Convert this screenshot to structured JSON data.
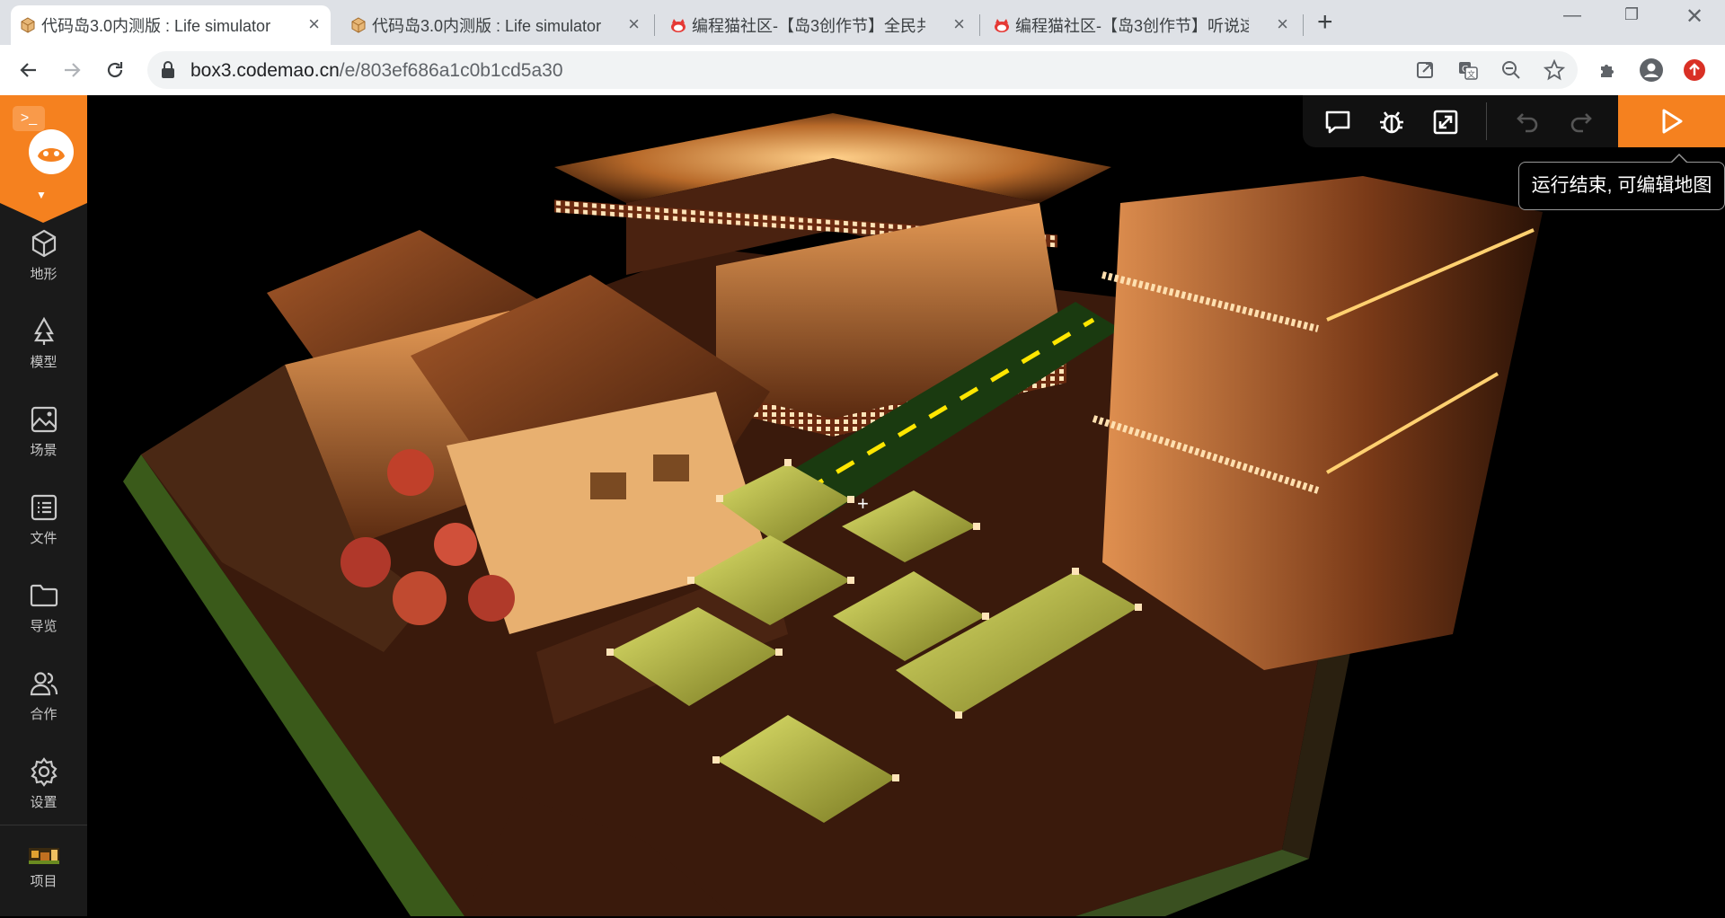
{
  "tabs": [
    {
      "title": "代码岛3.0内测版 : Life simulator",
      "active": true
    },
    {
      "title": "代码岛3.0内测版 : Life simulator",
      "active": false
    },
    {
      "title": "编程猫社区-【岛3创作节】全民共",
      "active": false
    },
    {
      "title": "编程猫社区-【岛3创作节】听说这"
    }
  ],
  "address": {
    "host": "box3.codemao.cn",
    "path": "/e/803ef686a1c0b1cd5a30"
  },
  "sidebar": {
    "items": [
      {
        "label": "地形",
        "icon": "cube-icon"
      },
      {
        "label": "模型",
        "icon": "tree-icon"
      },
      {
        "label": "场景",
        "icon": "image-icon"
      },
      {
        "label": "文件",
        "icon": "file-list-icon"
      },
      {
        "label": "导览",
        "icon": "folder-icon"
      },
      {
        "label": "合作",
        "icon": "users-icon"
      },
      {
        "label": "设置",
        "icon": "gear-icon"
      },
      {
        "label": "项目",
        "icon": "project-thumbnail-icon"
      }
    ]
  },
  "editor": {
    "tooltip": "运行结束, 可编辑地图"
  },
  "colors": {
    "accent": "#f5811f",
    "sidebar_bg": "#1a1a1a",
    "lantern_glow": "#ffb36b",
    "road_marking": "#ffe600",
    "grass": "#c8d24a"
  }
}
